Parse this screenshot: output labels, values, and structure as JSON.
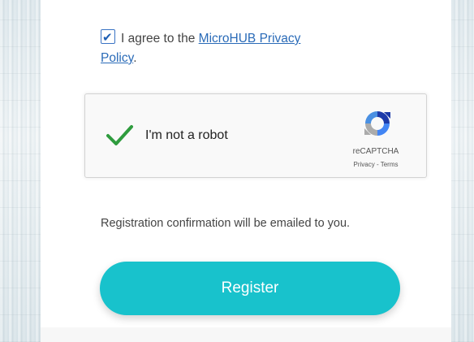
{
  "agreement": {
    "checked": true,
    "text_before": "I agree to the ",
    "link_text_1": "MicroHUB Privacy",
    "link_text_2": "Policy",
    "text_after": "."
  },
  "recaptcha": {
    "label": "I'm not a robot",
    "verified": true,
    "brand": "reCAPTCHA",
    "privacy_link": "Privacy",
    "separator": " - ",
    "terms_link": "Terms"
  },
  "notice": {
    "text": "Registration confirmation will be emailed to you."
  },
  "register_button": {
    "label": "Register",
    "color": "#18c2cc"
  },
  "icons": {
    "checkbox": "checkbox-checked-icon",
    "verified": "green-checkmark-icon",
    "recaptcha_logo": "recaptcha-logo-icon"
  }
}
